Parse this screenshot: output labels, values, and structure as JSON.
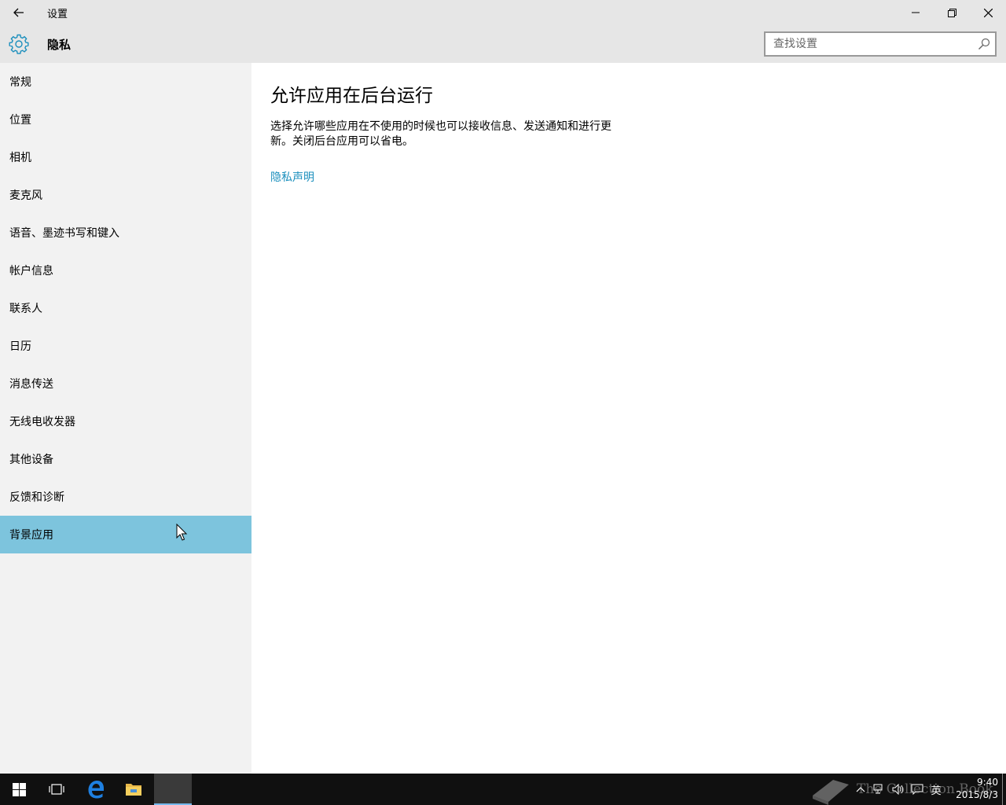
{
  "window": {
    "title": "设置",
    "back_label": "返回",
    "minimize_label": "最小化",
    "maximize_label": "还原",
    "close_label": "关闭"
  },
  "header": {
    "title": "隐私",
    "search_placeholder": "查找设置"
  },
  "sidebar": {
    "items": [
      {
        "label": "常规"
      },
      {
        "label": "位置"
      },
      {
        "label": "相机"
      },
      {
        "label": "麦克风"
      },
      {
        "label": "语音、墨迹书写和键入"
      },
      {
        "label": "帐户信息"
      },
      {
        "label": "联系人"
      },
      {
        "label": "日历"
      },
      {
        "label": "消息传送"
      },
      {
        "label": "无线电收发器"
      },
      {
        "label": "其他设备"
      },
      {
        "label": "反馈和诊断"
      },
      {
        "label": "背景应用",
        "selected": true
      }
    ]
  },
  "main": {
    "title": "允许应用在后台运行",
    "description": "选择允许哪些应用在不使用的时候也可以接收信息、发送通知和进行更新。关闭后台应用可以省电。",
    "privacy_link": "隐私声明"
  },
  "taskbar": {
    "ime": "英",
    "time": "9:40",
    "date": "2015/8/3"
  },
  "watermark": "The Collection Book",
  "colors": {
    "accent": "#7dc4dd",
    "link": "#1b8fbd",
    "titlebar": "#e6e6e6",
    "sidebar": "#f2f2f2",
    "taskbar": "#101010"
  }
}
